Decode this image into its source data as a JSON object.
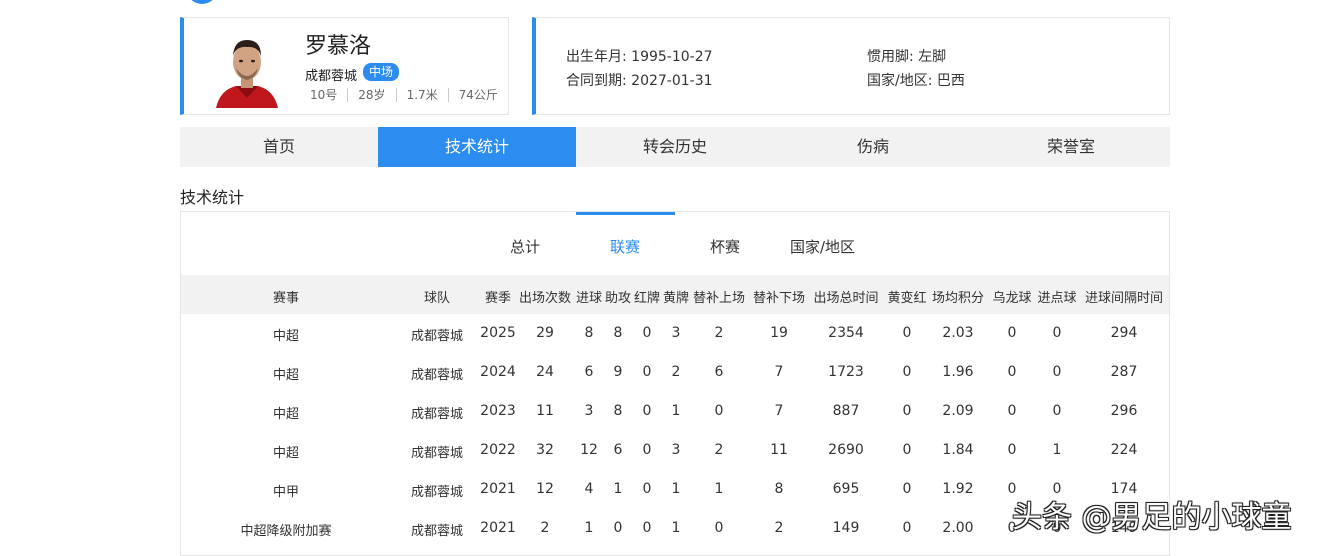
{
  "player": {
    "name": "罗慕洛",
    "club": "成都蓉城",
    "position": "中场",
    "number": "10号",
    "age": "28岁",
    "height": "1.7米",
    "weight": "74公斤"
  },
  "info": {
    "birth_label": "出生年月: 1995-10-27",
    "contract_label": "合同到期: 2027-01-31",
    "foot_label": "惯用脚: 左脚",
    "nation_label": "国家/地区: 巴西"
  },
  "main_tabs": [
    "首页",
    "技术统计",
    "转会历史",
    "伤病",
    "荣誉室"
  ],
  "active_main_tab": "技术统计",
  "section_title": "技术统计",
  "sub_tabs": [
    "总计",
    "联赛",
    "杯赛",
    "国家/地区"
  ],
  "active_sub_tab": "联赛",
  "table": {
    "headers": [
      "赛事",
      "球队",
      "赛季",
      "出场次数",
      "进球",
      "助攻",
      "红牌",
      "黄牌",
      "替补上场",
      "替补下场",
      "出场总时间",
      "黄变红",
      "场均积分",
      "乌龙球",
      "进点球",
      "进球间隔时间"
    ],
    "rows": [
      [
        "中超",
        "成都蓉城",
        "2025",
        "29",
        "8",
        "8",
        "0",
        "3",
        "2",
        "19",
        "2354",
        "0",
        "2.03",
        "0",
        "0",
        "294"
      ],
      [
        "中超",
        "成都蓉城",
        "2024",
        "24",
        "6",
        "9",
        "0",
        "2",
        "6",
        "7",
        "1723",
        "0",
        "1.96",
        "0",
        "0",
        "287"
      ],
      [
        "中超",
        "成都蓉城",
        "2023",
        "11",
        "3",
        "8",
        "0",
        "1",
        "0",
        "7",
        "887",
        "0",
        "2.09",
        "0",
        "0",
        "296"
      ],
      [
        "中超",
        "成都蓉城",
        "2022",
        "32",
        "12",
        "6",
        "0",
        "3",
        "2",
        "11",
        "2690",
        "0",
        "1.84",
        "0",
        "1",
        "224"
      ],
      [
        "中甲",
        "成都蓉城",
        "2021",
        "12",
        "4",
        "1",
        "0",
        "1",
        "1",
        "8",
        "695",
        "0",
        "1.92",
        "0",
        "0",
        "174"
      ],
      [
        "中超降级附加赛",
        "成都蓉城",
        "2021",
        "2",
        "1",
        "0",
        "0",
        "1",
        "0",
        "2",
        "149",
        "0",
        "2.00",
        "0",
        "0",
        "149"
      ]
    ]
  },
  "watermark": "头条 @男足的小球童",
  "colors": {
    "accent": "#2d8cf0",
    "tab_bg": "#f2f2f2"
  }
}
